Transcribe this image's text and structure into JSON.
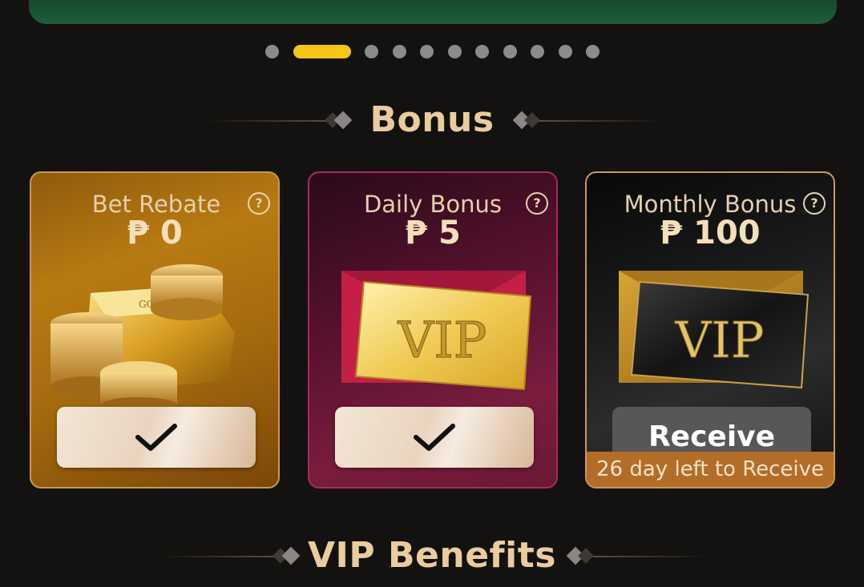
{
  "carousel": {
    "slide_count": 11,
    "active_index": 1
  },
  "bonus_section": {
    "title": "Bonus"
  },
  "cards": [
    {
      "title": "Bet Rebate",
      "amount": "₱ 0",
      "status": "claimed"
    },
    {
      "title": "Daily Bonus",
      "amount": "₱ 5",
      "status": "claimed",
      "vip_text": "VIP"
    },
    {
      "title": "Monthly Bonus",
      "amount": "₱ 100",
      "status": "available",
      "vip_text": "VIP",
      "button_label": "Receive",
      "countdown": "26 day left to Receive"
    }
  ],
  "help_icon_glyph": "?",
  "gold_bar_text": "GOLD",
  "vip_section": {
    "title": "VIP Benefits"
  },
  "colors": {
    "accent_gold": "#eacc9d",
    "active_dot": "#f5c518",
    "countdown_bar": "#b46d29"
  }
}
